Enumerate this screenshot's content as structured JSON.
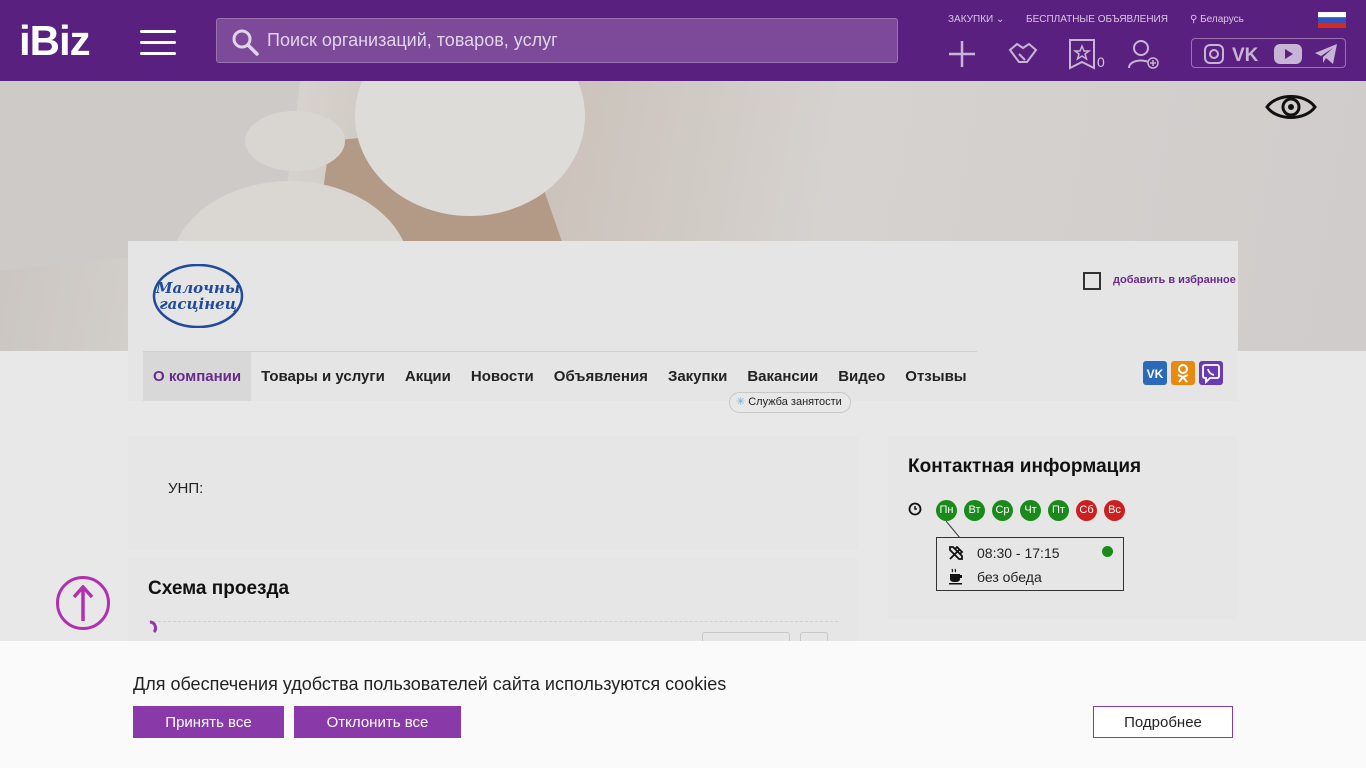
{
  "header": {
    "logo": "iBiz",
    "search_placeholder": "Поиск организаций, товаров, услуг",
    "links": {
      "procurement": "ЗАКУПКИ",
      "free_ads": "БЕСПЛАТНЫЕ ОБЪЯВЛЕНИЯ",
      "region": "Беларусь"
    },
    "favorites_count": "0"
  },
  "company": {
    "logo_text_line1": "Малочны",
    "logo_text_line2": "гасцінец",
    "add_favorite": "добавить в избранное",
    "tabs": [
      {
        "label": "О компании"
      },
      {
        "label": "Товары и услуги"
      },
      {
        "label": "Акции"
      },
      {
        "label": "Новости"
      },
      {
        "label": "Объявления"
      },
      {
        "label": "Закупки"
      },
      {
        "label": "Вакансии"
      },
      {
        "label": "Видео"
      },
      {
        "label": "Отзывы"
      }
    ],
    "employment_badge": "Служба занятости"
  },
  "about": {
    "unp_label": "УНП:"
  },
  "directions": {
    "title": "Схема проезда"
  },
  "contacts": {
    "title": "Контактная информация",
    "days": [
      {
        "label": "Пн",
        "status": "work"
      },
      {
        "label": "Вт",
        "status": "work"
      },
      {
        "label": "Ср",
        "status": "work"
      },
      {
        "label": "Чт",
        "status": "work"
      },
      {
        "label": "Пт",
        "status": "work"
      },
      {
        "label": "Сб",
        "status": "off"
      },
      {
        "label": "Вс",
        "status": "off"
      }
    ],
    "hours": "08:30 - 17:15",
    "lunch": "без обеда"
  },
  "cookies": {
    "text": "Для обеспечения удобства пользователей сайта используются cookies",
    "accept": "Принять все",
    "decline": "Отклонить все",
    "more": "Подробнее"
  },
  "colors": {
    "header_bg": "#5a2080",
    "accent": "#8a3aa8",
    "work_day": "#1a8a1a",
    "off_day": "#cc1f1f"
  }
}
